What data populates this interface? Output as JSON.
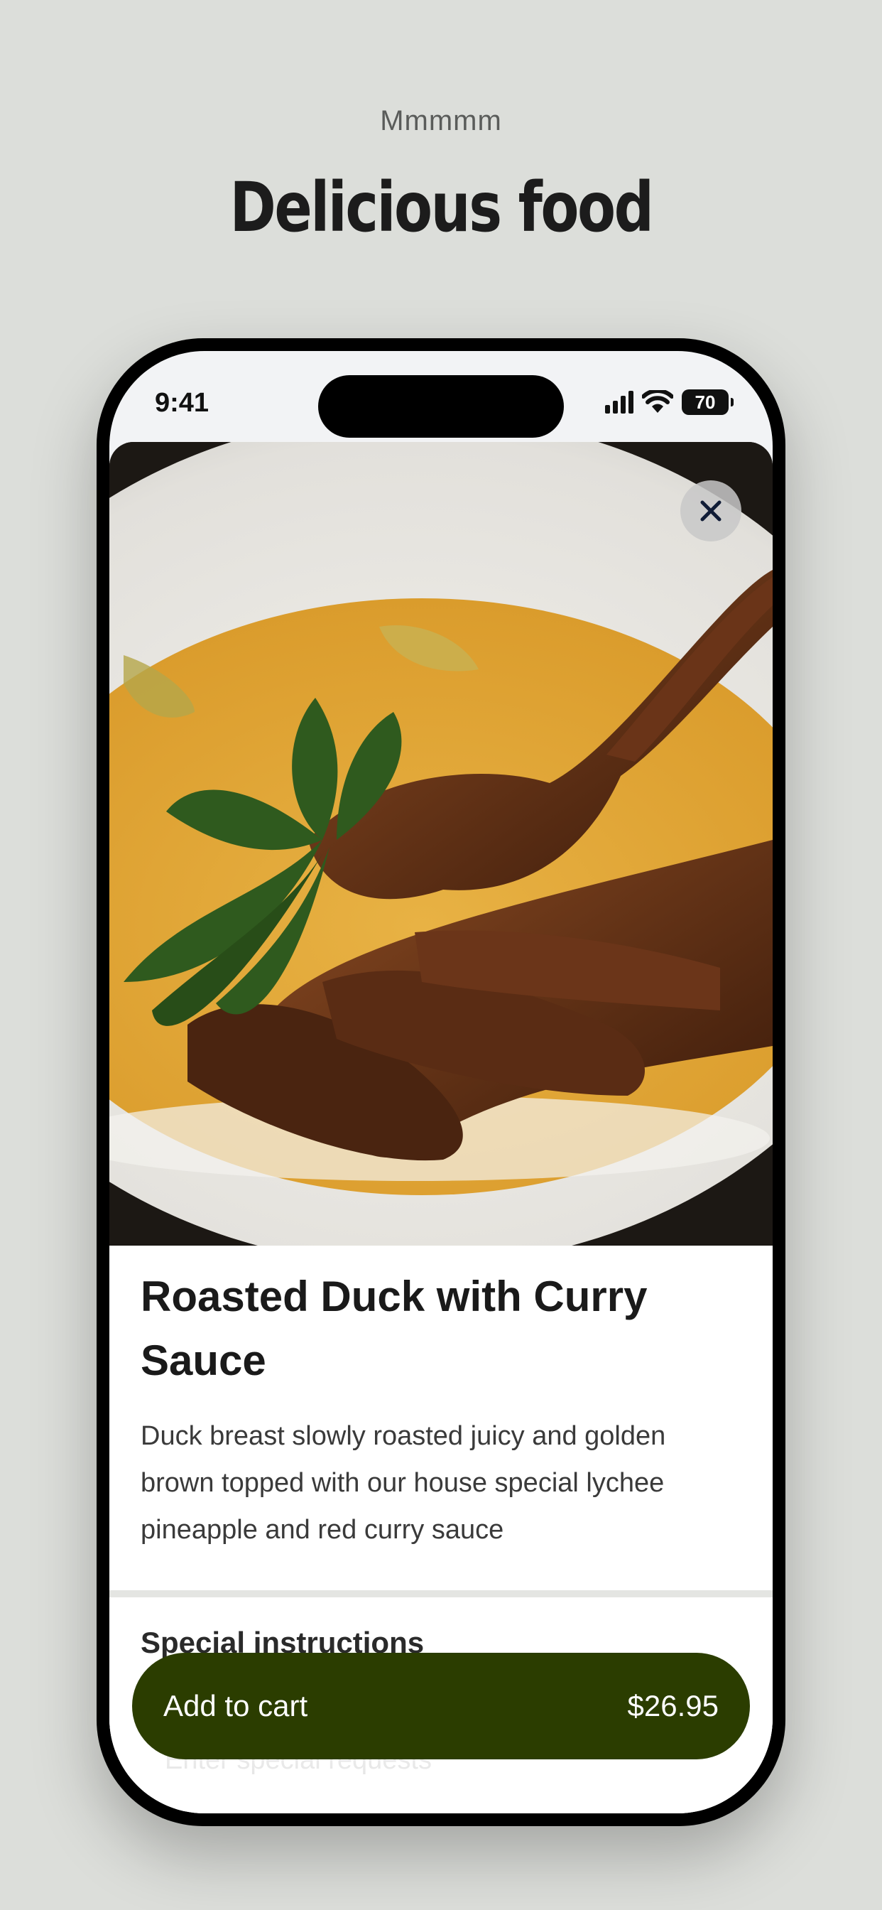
{
  "header": {
    "eyebrow": "Mmmmm",
    "headline": "Delicious food"
  },
  "status_bar": {
    "time": "9:41",
    "battery": "70"
  },
  "item": {
    "title": "Roasted Duck with Curry Sauce",
    "description": "Duck breast slowly roasted juicy and golden brown topped with our house special lychee pineapple and red curry sauce"
  },
  "special_instructions": {
    "label": "Special instructions",
    "placeholder": "Enter special requests"
  },
  "cart": {
    "label": "Add to cart",
    "price": "$26.95"
  },
  "colors": {
    "background": "#dcdeda",
    "accent": "#2b3d00"
  },
  "icons": {
    "close": "close-icon",
    "signal": "cellular-signal-icon",
    "wifi": "wifi-icon",
    "battery": "battery-icon"
  }
}
